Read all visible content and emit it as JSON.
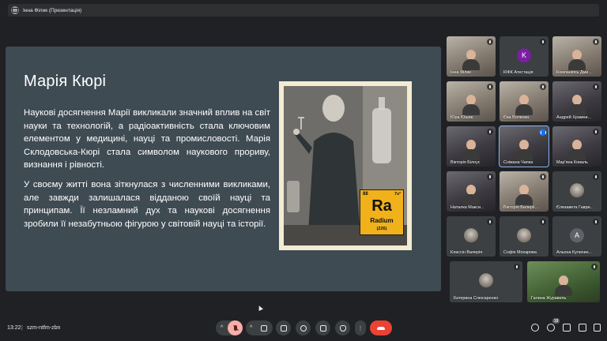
{
  "presenter": {
    "label": "Інна Філик (Презентація)"
  },
  "slide": {
    "title": "Марія Кюрі",
    "paragraph1": "Наукові досягнення Марії викликали значний вплив на світ науки та технологій, а радіоактивність стала ключовим елементом у медицині, науці та промисловості. Марія Склодовська-Кюрі стала символом наукового прориву, визнання і рівності.",
    "paragraph2": "У своєму житті вона зіткнулася з численними викликами, але завжди залишалася відданою своїй науці та принципам. Її незламний дух та наукові досягнення зробили її незабутньою фігурою у світовій науці та історії.",
    "element": {
      "number": "88",
      "config": "7s²",
      "symbol": "Ra",
      "name": "Radium",
      "mass": "(226)"
    }
  },
  "participants": [
    {
      "name": "Інна Філик",
      "kind": "video",
      "muted": true
    },
    {
      "name": "КІФК Атестація",
      "kind": "avatar",
      "initial": "K",
      "color": "#7b1fa2",
      "muted": true
    },
    {
      "name": "Компаніясь Дми...",
      "kind": "video",
      "muted": true
    },
    {
      "name": "Юра Юшик",
      "kind": "video",
      "muted": true
    },
    {
      "name": "Єва Волкова",
      "kind": "video",
      "muted": true
    },
    {
      "name": "Андрей Храмни...",
      "kind": "video-dark",
      "muted": true
    },
    {
      "name": "Вікторія Білоус",
      "kind": "video-dark",
      "muted": true
    },
    {
      "name": "Сніжана Чапка",
      "kind": "video-dark",
      "speaking": true,
      "active": true
    },
    {
      "name": "Мар'яна Коваль",
      "kind": "video-dark",
      "muted": true
    },
    {
      "name": "Наталка Макси...",
      "kind": "video-dark",
      "muted": true
    },
    {
      "name": "Вікторія Валерії...",
      "kind": "video",
      "muted": true
    },
    {
      "name": "Єлизавета Гаври...",
      "kind": "avatar-photo",
      "muted": true
    },
    {
      "name": "Классін Валерія",
      "kind": "avatar-photo",
      "muted": true
    },
    {
      "name": "Софія Мохарова",
      "kind": "avatar-photo",
      "muted": true
    },
    {
      "name": "Альона Кулачин...",
      "kind": "avatar",
      "initial": "A",
      "color": "#5f6368",
      "muted": true
    },
    {
      "name": "Катерина Слюсаренко",
      "kind": "avatar-photo",
      "muted": true
    },
    {
      "name": "Галина Журавель",
      "kind": "video-green",
      "muted": true
    }
  ],
  "bottom": {
    "time": "13:22",
    "separator": "|",
    "meeting_code": "szm-ntfm-zbn",
    "participants_count": "18"
  },
  "icons": [
    "caret-up-icon",
    "mic-off-icon",
    "camera-icon",
    "captions-icon",
    "emoji-icon",
    "present-icon",
    "raise-hand-icon",
    "more-icon",
    "hangup-icon",
    "info-icon",
    "people-icon",
    "chat-icon",
    "activities-icon"
  ]
}
